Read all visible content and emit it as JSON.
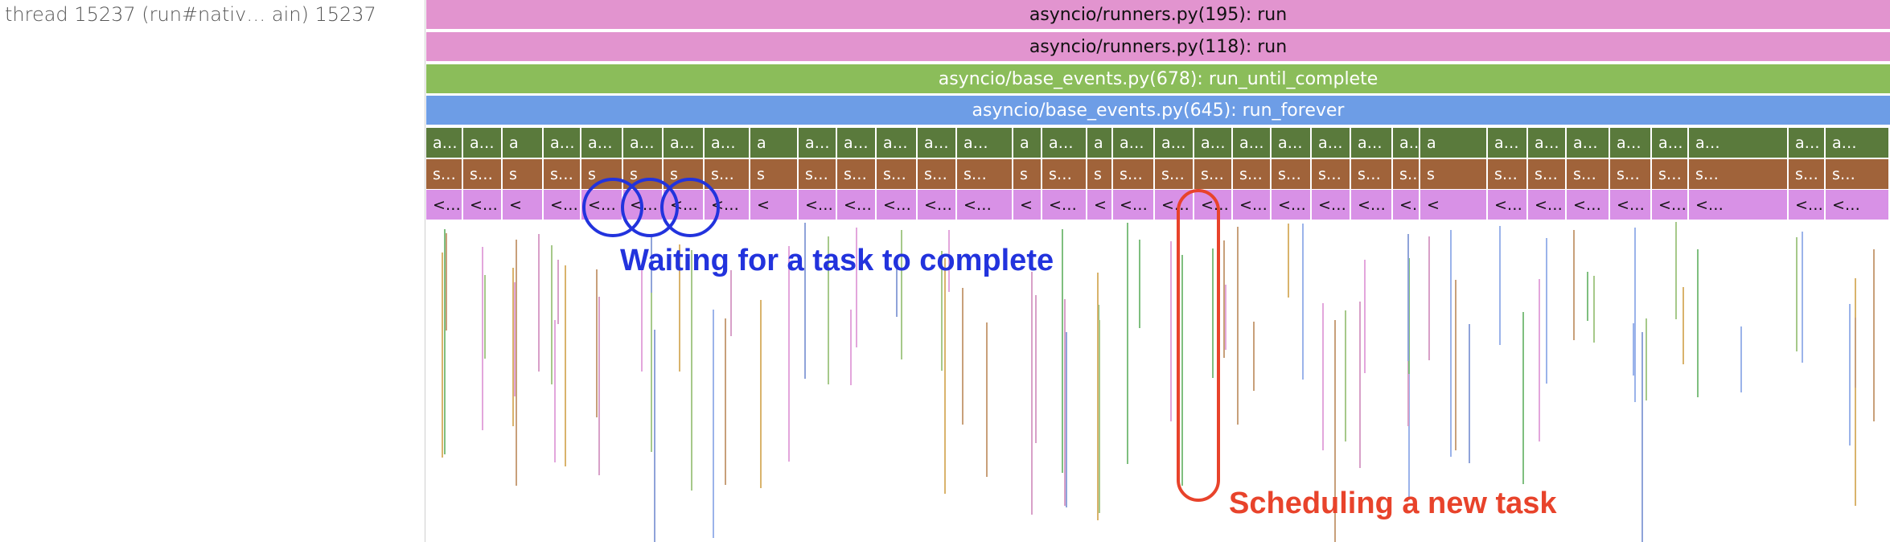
{
  "thread": {
    "label": "thread 15237 (run#nativ… ain) 15237"
  },
  "flamegraph": {
    "stack_rows": [
      {
        "label": "asyncio/runners.py(195): run",
        "color": "#e294cf"
      },
      {
        "label": "asyncio/runners.py(118): run",
        "color": "#e294cf"
      },
      {
        "label": "asyncio/base_events.py(678): run_until_complete",
        "color": "#8bbd5a"
      },
      {
        "label": "asyncio/base_events.py(645): run_forever",
        "color": "#6d9de6"
      }
    ],
    "frame_rows": {
      "dark_green": {
        "color": "#5a7a3c",
        "text_color": "#ffffff"
      },
      "brown": {
        "color": "#a0633a",
        "text_color": "#ffffff"
      },
      "violet": {
        "color": "#d891e6",
        "text_color": "#111111"
      }
    },
    "frames": [
      {
        "a": "a…",
        "s": "s…",
        "v": "<…"
      },
      {
        "a": "a…",
        "s": "s…",
        "v": "<…"
      },
      {
        "a": "a",
        "s": "s",
        "v": "<"
      },
      {
        "a": "a…",
        "s": "s…",
        "v": "<…"
      },
      {
        "a": "a…",
        "s": "s",
        "v": "<…"
      },
      {
        "a": "a…",
        "s": "s",
        "v": "<…"
      },
      {
        "a": "a…",
        "s": "s",
        "v": "<…"
      },
      {
        "a": "a…",
        "s": "s…",
        "v": "<…"
      },
      {
        "a": "a",
        "s": "s",
        "v": "<"
      },
      {
        "a": "a…",
        "s": "s…",
        "v": "<…"
      },
      {
        "a": "a…",
        "s": "s…",
        "v": "<…"
      },
      {
        "a": "a…",
        "s": "s…",
        "v": "<…"
      },
      {
        "a": "a…",
        "s": "s…",
        "v": "<…"
      },
      {
        "a": "a…",
        "s": "s…",
        "v": "<…"
      },
      {
        "a": "a",
        "s": "s",
        "v": "<"
      },
      {
        "a": "a…",
        "s": "s…",
        "v": "<…"
      },
      {
        "a": "a",
        "s": "s",
        "v": "<"
      },
      {
        "a": "a…",
        "s": "s…",
        "v": "<…"
      },
      {
        "a": "a…",
        "s": "s…",
        "v": "<…"
      },
      {
        "a": "a…",
        "s": "s…",
        "v": "<…"
      },
      {
        "a": "a…",
        "s": "s…",
        "v": "<…"
      },
      {
        "a": "a…",
        "s": "s…",
        "v": "<…"
      },
      {
        "a": "a…",
        "s": "s…",
        "v": "<…"
      },
      {
        "a": "a…",
        "s": "s…",
        "v": "<…"
      },
      {
        "a": "a…",
        "s": "s…",
        "v": "<…"
      },
      {
        "a": "a",
        "s": "s",
        "v": "<"
      },
      {
        "a": "a…",
        "s": "s…",
        "v": "<…"
      },
      {
        "a": "a…",
        "s": "s…",
        "v": "<…"
      },
      {
        "a": "a…",
        "s": "s…",
        "v": "<…"
      },
      {
        "a": "a…",
        "s": "s…",
        "v": "<…"
      },
      {
        "a": "a…",
        "s": "s…",
        "v": "<…"
      },
      {
        "a": "a…",
        "s": "s…",
        "v": "<…"
      },
      {
        "a": "a…",
        "s": "s…",
        "v": "<…"
      },
      {
        "a": "a…",
        "s": "s…",
        "v": "<…"
      }
    ],
    "sliver_colors": [
      "#a6c98a",
      "#e3a6dc",
      "#9bb3ea",
      "#c8a07a",
      "#7fbf7f",
      "#d9b36c",
      "#8fa3d9",
      "#d8a0c8"
    ]
  },
  "annotations": {
    "waiting": {
      "text": "Waiting for a task to complete",
      "color": "#2233dd"
    },
    "scheduling": {
      "text": "Scheduling a new task",
      "color": "#e8432b"
    }
  }
}
